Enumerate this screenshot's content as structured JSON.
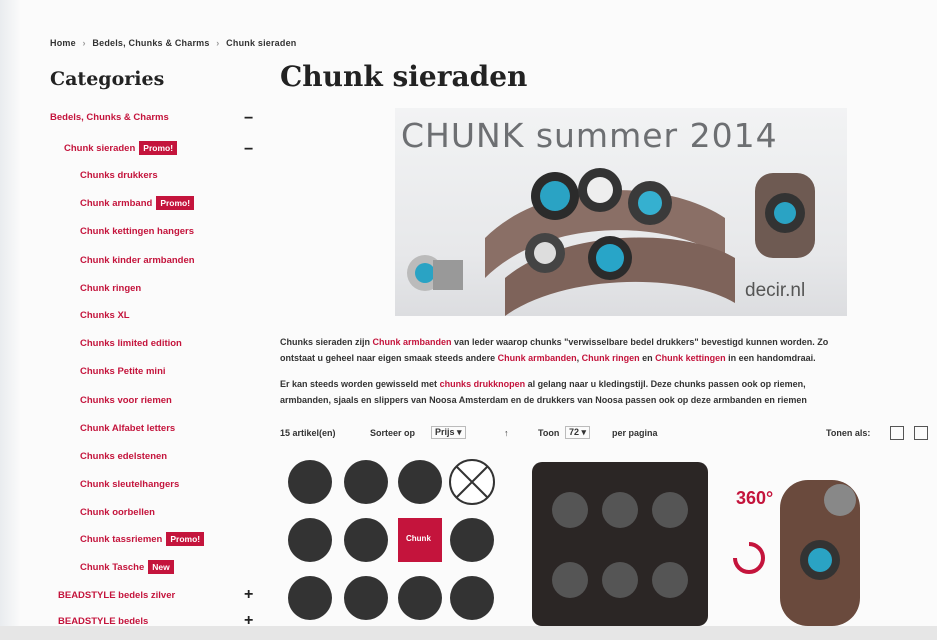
{
  "breadcrumb": {
    "home": "Home",
    "level1": "Bedels, Chunks & Charms",
    "level2": "Chunk sieraden",
    "separator": "›"
  },
  "sidebar": {
    "title": "Categories",
    "items": [
      {
        "label": "Bedels, Chunks & Charms",
        "toggle": "−"
      },
      {
        "label": "Chunk sieraden",
        "badge": "Promo!",
        "toggle": "−"
      },
      {
        "label": "Chunks drukkers"
      },
      {
        "label": "Chunk armband",
        "badge": "Promo!"
      },
      {
        "label": "Chunk kettingen hangers"
      },
      {
        "label": "Chunk kinder armbanden"
      },
      {
        "label": "Chunk ringen"
      },
      {
        "label": "Chunks XL"
      },
      {
        "label": "Chunks limited edition"
      },
      {
        "label": "Chunks Petite mini"
      },
      {
        "label": "Chunks voor riemen"
      },
      {
        "label": "Chunk Alfabet letters"
      },
      {
        "label": "Chunks edelstenen"
      },
      {
        "label": "Chunk sleutelhangers"
      },
      {
        "label": "Chunk oorbellen"
      },
      {
        "label": "Chunk tassriemen",
        "badge": "Promo!"
      },
      {
        "label": "Chunk Tasche",
        "badge": "New"
      },
      {
        "label": "BEADSTYLE bedels zilver",
        "toggle": "+"
      },
      {
        "label": "BEADSTYLE bedels",
        "toggle": "+"
      }
    ]
  },
  "main": {
    "title": "Chunk sieraden",
    "banner": {
      "title": "CHUNK summer 2014",
      "footer": "decir.nl"
    },
    "para1": {
      "a": "Chunks sieraden zijn ",
      "link1": "Chunk armbanden",
      "b": " van leder waarop chunks \"verwisselbare bedel drukkers\" bevestigd kunnen worden. Zo",
      "c": "ontstaat u geheel naar eigen smaak steeds andere ",
      "link2": "Chunk armbanden",
      "d": ", ",
      "link3": "Chunk ringen",
      "e": " en ",
      "link4": "Chunk kettingen",
      "f": " in een handomdraai."
    },
    "para2": {
      "a": "Er kan steeds worden gewisseld met ",
      "link1": "chunks drukknopen",
      "b": " al gelang naar u kledingstijl. Deze chunks passen ook op riemen,",
      "c": "armbanden, sjaals en slippers van Noosa Amsterdam en de drukkers van Noosa passen ook op deze armbanden en riemen"
    },
    "toolbar": {
      "count": "15 artikel(en)",
      "sort_label": "Sorteer op",
      "sort_value": "Prijs",
      "sort_dir": "↑",
      "show_label": "Toon",
      "show_value": "72",
      "per_page": "per pagina",
      "view_label": "Tonen als:"
    },
    "badge360": "360°",
    "chunk_tile": "Chunk"
  },
  "colors": {
    "accent": "#c4143c"
  },
  "icons": [
    "toggle-minus-icon",
    "toggle-plus-icon",
    "grid-view-icon",
    "list-view-icon",
    "rotate-icon"
  ]
}
